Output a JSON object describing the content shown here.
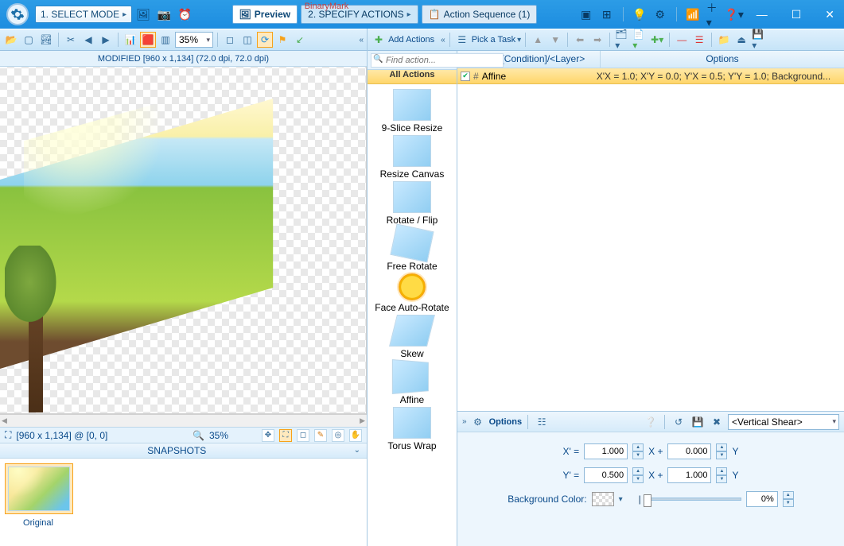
{
  "app": {
    "title": "BinaryMark"
  },
  "steps": {
    "select_mode": "1. SELECT MODE",
    "specify_actions": "2. SPECIFY ACTIONS"
  },
  "tabs": {
    "preview": "Preview",
    "action_sequence": "Action Sequence (1)"
  },
  "toolbar_left": {
    "zoom": "35%"
  },
  "preview": {
    "header": "MODIFIED [960 x 1,134] (72.0 dpi, 72.0 dpi)",
    "status_coords": "[960 x 1,134] @ [0, 0]",
    "status_zoom": "35%"
  },
  "snapshots": {
    "title": "SNAPSHOTS",
    "items": [
      {
        "label": "Original"
      }
    ]
  },
  "actions_panel": {
    "add_actions": "Add Actions",
    "find_placeholder": "Find action...",
    "all_actions": "All Actions",
    "items": [
      "9-Slice Resize",
      "Resize Canvas",
      "Rotate / Flip",
      "Free Rotate",
      "Face Auto-Rotate",
      "Skew",
      "Affine",
      "Torus Wrap"
    ]
  },
  "sequence": {
    "pick_task": "Pick a Task",
    "col_action": "Action/[Condition]/<Layer>",
    "col_options": "Options",
    "rows": [
      {
        "checked": true,
        "name": "Affine",
        "opts": "X'X = 1.0; X'Y = 0.0; Y'X = 0.5; Y'Y = 1.0; Background..."
      }
    ]
  },
  "options": {
    "title": "Options",
    "preset": "<Vertical Shear>",
    "x_prime": "X' =",
    "y_prime": "Y' =",
    "xplus": "X +",
    "y_suffix": "Y",
    "xx": "1.000",
    "xy": "0.000",
    "yx": "0.500",
    "yy": "1.000",
    "bg_label": "Background Color:",
    "opacity": "0%"
  }
}
